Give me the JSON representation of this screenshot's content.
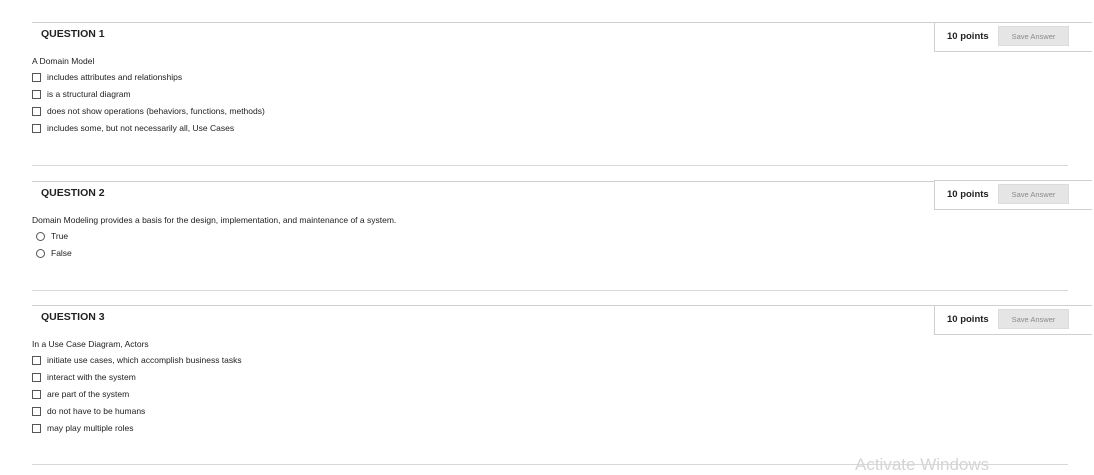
{
  "questions": [
    {
      "title": "QUESTION 1",
      "points": "10 points",
      "save_label": "Save Answer",
      "prompt": "A Domain Model",
      "type": "checkbox",
      "options": [
        "includes attributes and relationships",
        "is a structural diagram",
        "does not show operations (behaviors, functions, methods)",
        "includes some, but not necessarily all, Use Cases"
      ]
    },
    {
      "title": "QUESTION 2",
      "points": "10 points",
      "save_label": "Save Answer",
      "prompt": "Domain Modeling provides a basis for the design, implementation, and maintenance of a system.",
      "type": "radio",
      "options": [
        "True",
        "False"
      ]
    },
    {
      "title": "QUESTION 3",
      "points": "10 points",
      "save_label": "Save Answer",
      "prompt": "In a Use Case Diagram, Actors",
      "type": "checkbox",
      "options": [
        "initiate use cases, which accomplish business tasks",
        "interact with the system",
        "are part of the system",
        "do not have to be humans",
        "may play multiple roles"
      ]
    }
  ],
  "watermark": "Activate Windows"
}
